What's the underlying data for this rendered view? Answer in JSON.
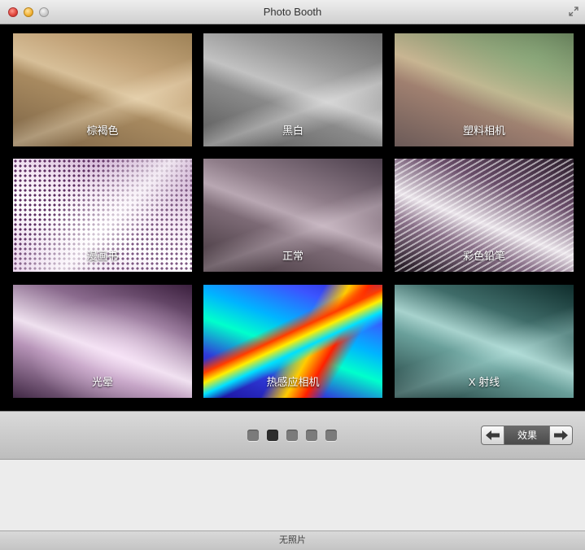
{
  "window": {
    "title": "Photo Booth"
  },
  "effects": {
    "tiles": [
      {
        "label": "棕褐色"
      },
      {
        "label": "黑白"
      },
      {
        "label": "塑料相机"
      },
      {
        "label": "漫画书"
      },
      {
        "label": "正常"
      },
      {
        "label": "彩色铅笔"
      },
      {
        "label": "光晕"
      },
      {
        "label": "热感应相机"
      },
      {
        "label": "X 射线"
      }
    ]
  },
  "toolbar": {
    "pages_total": 5,
    "page_active": 2,
    "effects_label": "效果"
  },
  "status": {
    "text": "无照片"
  }
}
